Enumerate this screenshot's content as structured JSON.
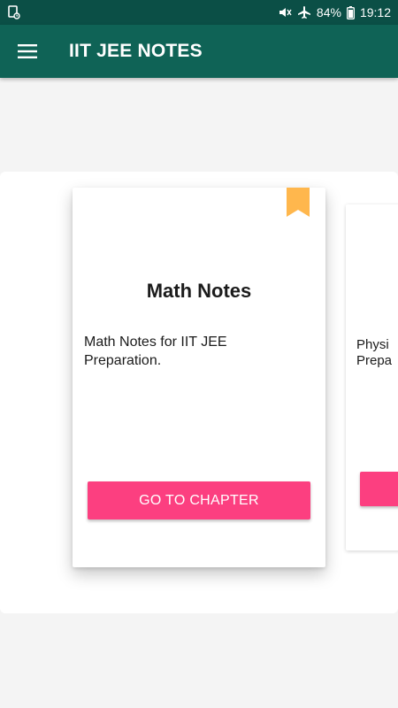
{
  "status_bar": {
    "battery": "84%",
    "time": "19:12",
    "icons": [
      "notification-icon",
      "mute-icon",
      "airplane-mode-icon",
      "battery-icon"
    ]
  },
  "app_bar": {
    "title": "IIT JEE NOTES",
    "menu_icon": "hamburger-menu-icon"
  },
  "cards": [
    {
      "title": "Math Notes",
      "description": "Math Notes for IIT JEE Preparation.",
      "button_label": "GO TO CHAPTER",
      "bookmark_icon": "bookmark-icon"
    },
    {
      "description_partial": "Physi\nPrepa"
    }
  ],
  "colors": {
    "status_bar": "#0b4f46",
    "app_bar": "#0f6356",
    "button": "#fc3f80",
    "bookmark": "#ffb74d",
    "background": "#f4f4f4"
  }
}
